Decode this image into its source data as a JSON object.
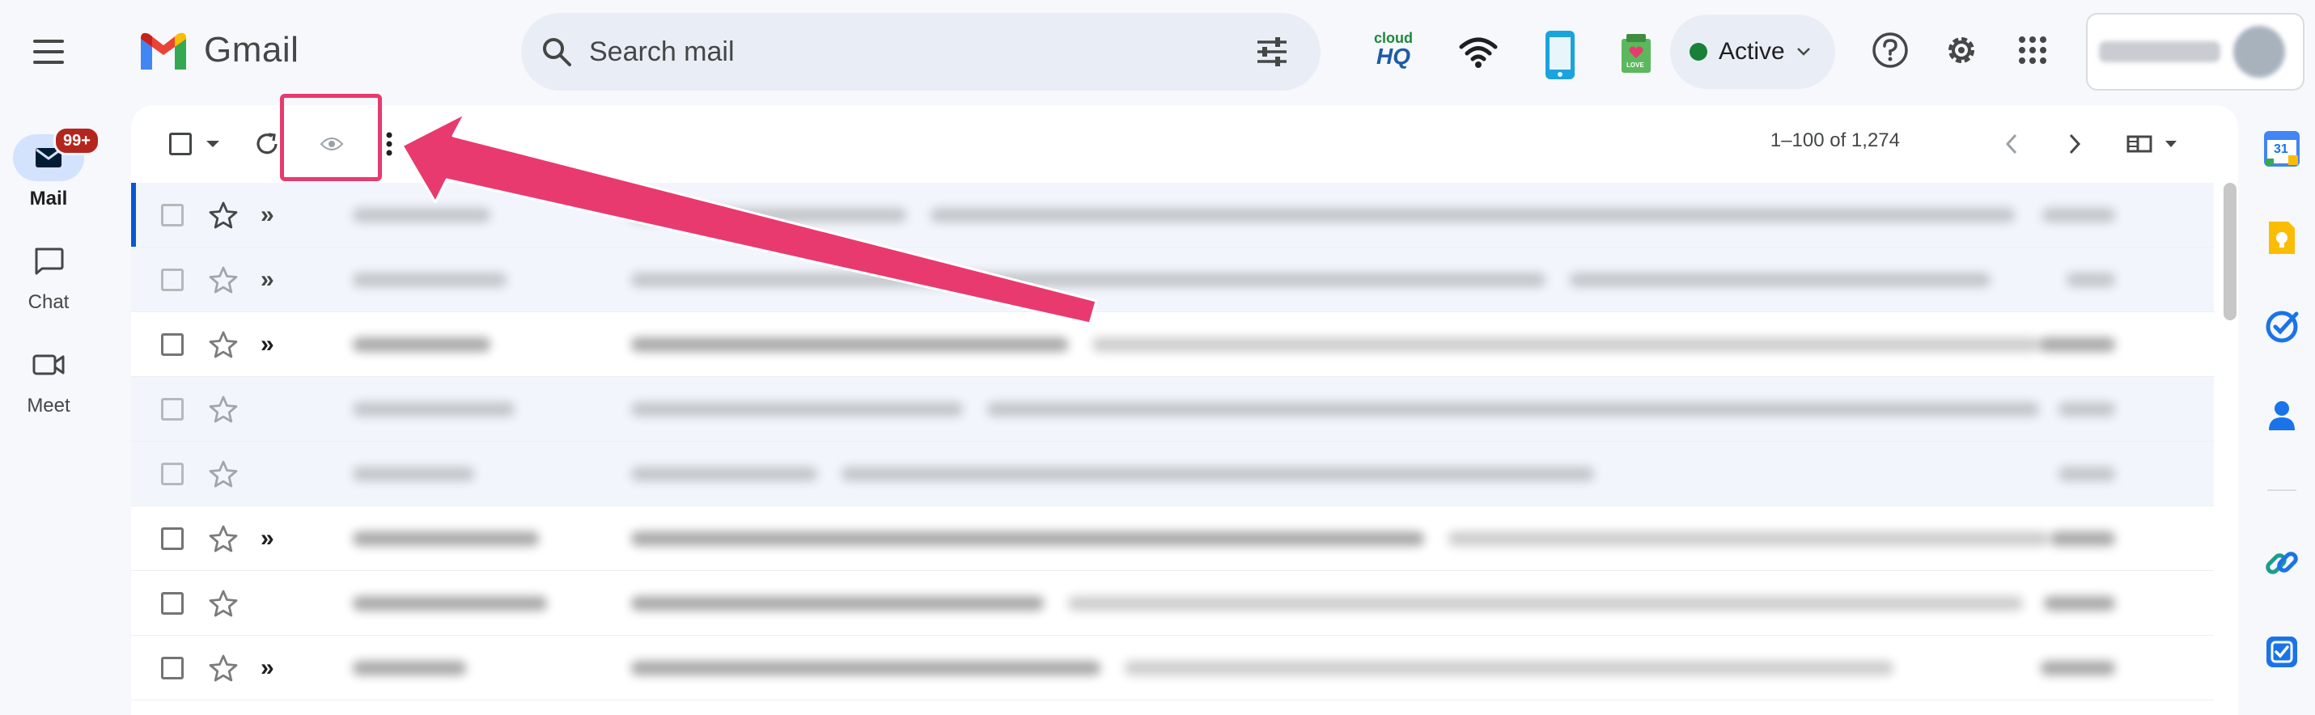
{
  "app": {
    "name": "Gmail"
  },
  "nav": {
    "items": [
      {
        "label": "Mail",
        "badge": "99+",
        "active": true,
        "icon": "mail-icon"
      },
      {
        "label": "Chat",
        "active": false,
        "icon": "chat-icon"
      },
      {
        "label": "Meet",
        "active": false,
        "icon": "video-icon"
      }
    ]
  },
  "search": {
    "placeholder": "Search mail"
  },
  "extensions": {
    "cloudhq_top": "cloud",
    "cloudhq_bottom": "HQ",
    "love_label": "LOVE"
  },
  "status": {
    "label": "Active",
    "color": "#188038"
  },
  "toolbar": {
    "pagination": "1–100 of 1,274"
  },
  "rows": [
    {
      "state": "read",
      "important": true,
      "starred": false
    },
    {
      "state": "read",
      "important": true,
      "starred": false
    },
    {
      "state": "unread",
      "important": true,
      "starred": false
    },
    {
      "state": "read",
      "important": false,
      "starred": false
    },
    {
      "state": "read",
      "important": false,
      "starred": false
    },
    {
      "state": "unread",
      "important": true,
      "starred": false
    },
    {
      "state": "unread",
      "important": false,
      "starred": false
    },
    {
      "state": "unread",
      "important": true,
      "starred": false
    }
  ],
  "right_rail": {
    "calendar_day": "31",
    "apps": [
      "calendar-icon",
      "keep-icon",
      "tasks-icon",
      "contacts-icon",
      "link-icon",
      "checklist-icon"
    ]
  },
  "colors": {
    "annotation": "#e83a6e",
    "accent": "#0b57d0",
    "badge": "#b3261e"
  }
}
